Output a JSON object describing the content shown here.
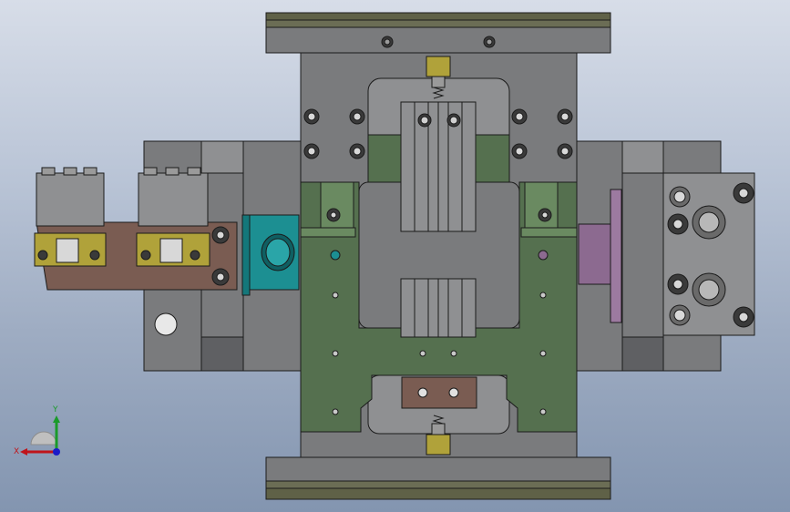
{
  "viewport": {
    "background_top": "#d7dde8",
    "background_bottom": "#8395b0"
  },
  "model": {
    "colors": {
      "steel_gray": "#7a7b7d",
      "steel_light": "#8f9092",
      "steel_dark": "#5f6063",
      "plate_olive": "#5f6147",
      "green_plate": "#55704f",
      "green_light": "#6a8a61",
      "brown_block": "#7a5c52",
      "teal_cylinder": "#1c8f92",
      "purple_cylinder": "#8c6a90",
      "yellow_clamp": "#b0a23a",
      "outline": "#1b1b1b"
    }
  },
  "triad": {
    "x_label": "X",
    "y_label": "Y",
    "x_color": "#c0141a",
    "y_color": "#1a9a2a",
    "z_color": "#1a1ac8"
  }
}
